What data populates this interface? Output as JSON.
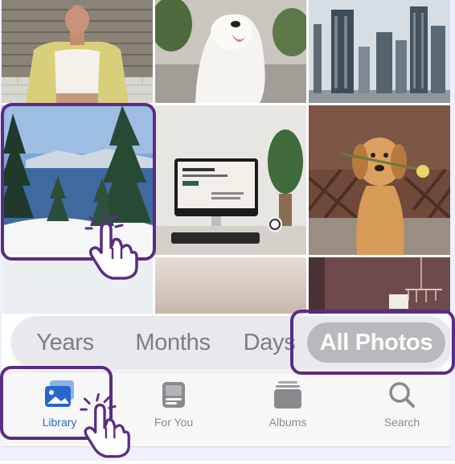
{
  "view_selector": {
    "options": [
      "Years",
      "Months",
      "Days",
      "All Photos"
    ],
    "selected": "All Photos"
  },
  "tab_bar": {
    "tabs": [
      {
        "label": "Library",
        "icon": "photo-stack-icon",
        "active": true
      },
      {
        "label": "For You",
        "icon": "for-you-icon",
        "active": false
      },
      {
        "label": "Albums",
        "icon": "albums-icon",
        "active": false
      },
      {
        "label": "Search",
        "icon": "search-icon",
        "active": false
      }
    ]
  },
  "photos": [
    "person-portrait",
    "white-dog",
    "city-skyline",
    "snowy-lake",
    "desk-computer",
    "dog-with-flower",
    "sky",
    "clouds",
    "room-chandelier"
  ],
  "colors": {
    "highlight": "#5b2c83",
    "active_tab": "#2a66c9",
    "segment_active_bg": "#b9b9bd"
  }
}
